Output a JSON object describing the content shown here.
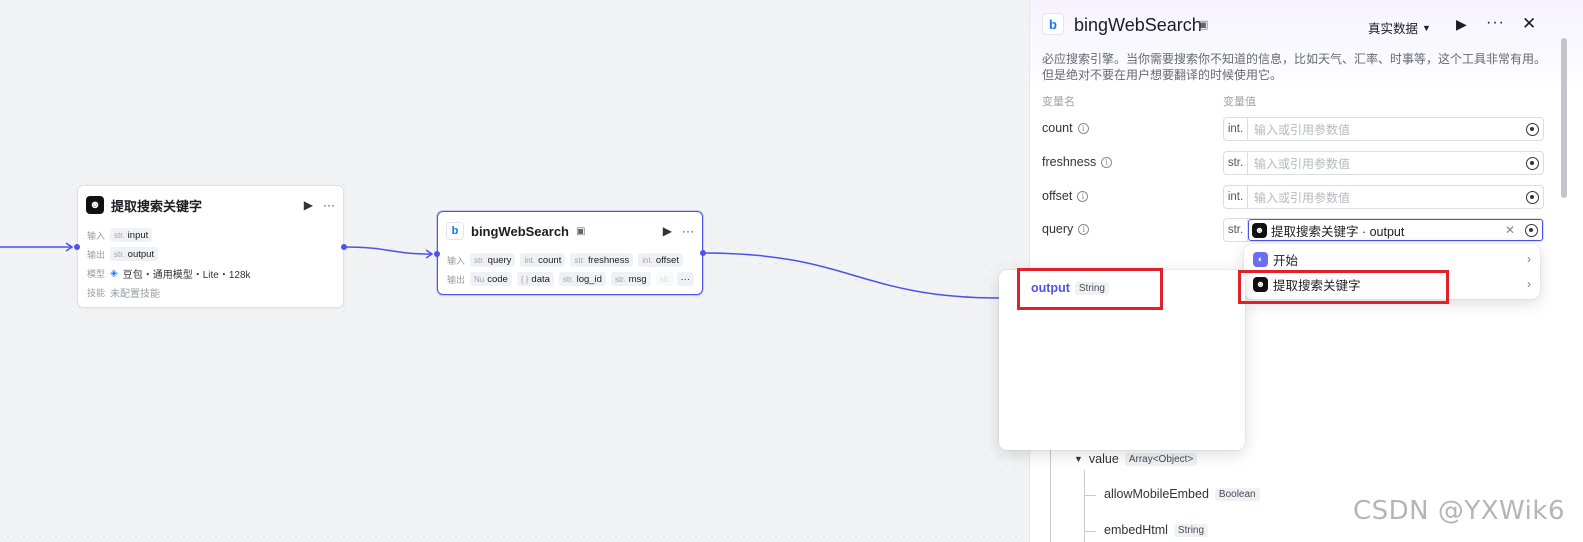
{
  "node_extract": {
    "title": "提取搜索关键字",
    "input_label": "输入",
    "input_tag_type": "str.",
    "input_tag_name": "input",
    "output_label": "输出",
    "output_tag_type": "str.",
    "output_tag_name": "output",
    "model_label": "模型",
    "model_value": "豆包・通用模型・Lite・128k",
    "skill_label": "技能",
    "skill_value": "未配置技能"
  },
  "node_bing": {
    "title": "bingWebSearch",
    "input_label": "输入",
    "inputs": [
      {
        "type": "str.",
        "name": "query"
      },
      {
        "type": "int.",
        "name": "count"
      },
      {
        "type": "str.",
        "name": "freshness"
      },
      {
        "type": "int.",
        "name": "offset"
      }
    ],
    "output_label": "输出",
    "outputs": [
      {
        "type": "Nu",
        "name": "code"
      },
      {
        "type": "{ }",
        "name": "data"
      },
      {
        "type": "str.",
        "name": "log_id"
      },
      {
        "type": "str.",
        "name": "msg"
      },
      {
        "type": "str.",
        "name": ""
      }
    ],
    "more": "···"
  },
  "panel": {
    "title": "bingWebSearch",
    "mode_label": "真实数据",
    "description": "必应搜索引擎。当你需要搜索你不知道的信息，比如天气、汇率、时事等，这个工具非常有用。但是绝对不要在用户想要翻译的时候使用它。",
    "col_name": "变量名",
    "col_value": "变量值",
    "variables": [
      {
        "name": "count",
        "type": "int.",
        "placeholder": "输入或引用参数值"
      },
      {
        "name": "freshness",
        "type": "str.",
        "placeholder": "输入或引用参数值"
      },
      {
        "name": "offset",
        "type": "int.",
        "placeholder": "输入或引用参数值"
      },
      {
        "name": "query",
        "type": "str.",
        "ref_value": "提取搜索关键字 · output"
      }
    ]
  },
  "node_dropdown": {
    "items": [
      "开始",
      "提取搜索关键字"
    ]
  },
  "output_dropdown": {
    "field_name": "output",
    "field_type": "String"
  },
  "output_tree": [
    {
      "name": "value",
      "type": "Array<Object>"
    },
    {
      "name": "allowMobileEmbed",
      "type": "Boolean"
    },
    {
      "name": "embedHtml",
      "type": "String"
    }
  ],
  "watermark": "CSDN @YXWik6",
  "colors": {
    "accent": "#4d53e8",
    "highlight_box": "#e0202b"
  }
}
